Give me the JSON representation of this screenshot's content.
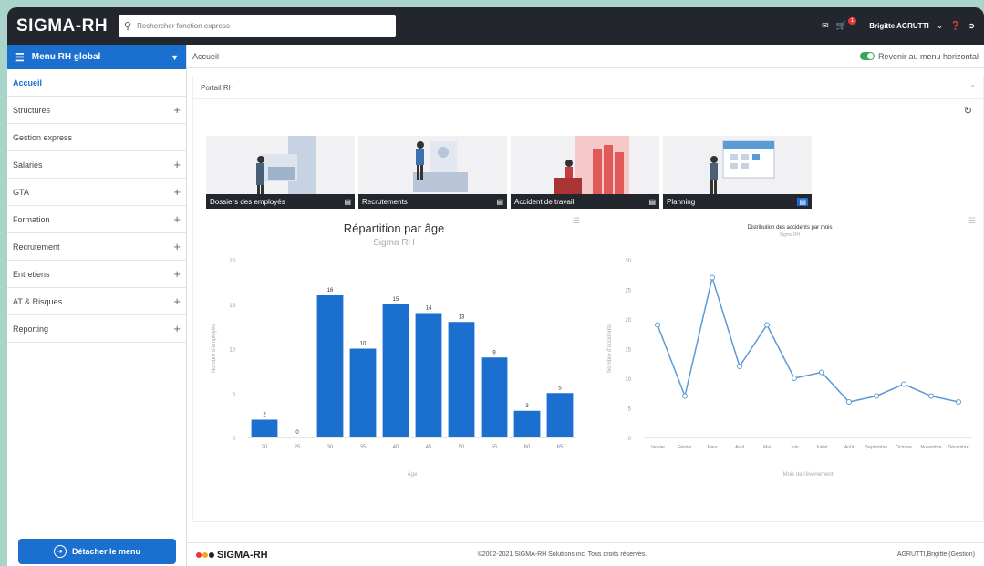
{
  "app": {
    "logo": "SIGMA-RH"
  },
  "search": {
    "placeholder": "Rechercher fonction express"
  },
  "header": {
    "user": "Brigitte AGRUTTI",
    "notif_count": "1"
  },
  "sidebar": {
    "title": "Menu RH global",
    "items": [
      {
        "label": "Accueil",
        "expandable": false,
        "active": true
      },
      {
        "label": "Structures",
        "expandable": true
      },
      {
        "label": "Gestion express",
        "expandable": false
      },
      {
        "label": "Salariés",
        "expandable": true
      },
      {
        "label": "GTA",
        "expandable": true
      },
      {
        "label": "Formation",
        "expandable": true
      },
      {
        "label": "Recrutement",
        "expandable": true
      },
      {
        "label": "Entretiens",
        "expandable": true
      },
      {
        "label": "AT & Risques",
        "expandable": true
      },
      {
        "label": "Reporting",
        "expandable": true
      }
    ],
    "detach_label": "Détacher le menu"
  },
  "breadcrumb": "Accueil",
  "toggle_label": "Revenir au menu horizontal",
  "panel": {
    "title": "Portail RH"
  },
  "tiles": [
    {
      "label": "Dossiers des employés"
    },
    {
      "label": "Recrutements"
    },
    {
      "label": "Accident de travail"
    },
    {
      "label": "Planning"
    }
  ],
  "footer": {
    "logo": "SIGMA-RH",
    "copyright": "©2002-2021 SIGMA-RH Solutions inc. Tous droits réservés.",
    "user": "AGRUTTI,Brigitte (Gestion)"
  },
  "colors": {
    "accent": "#1a6fcf",
    "topbar": "#23262d",
    "line": "#5b9bd5"
  },
  "chart_data": [
    {
      "type": "bar",
      "title": "Répartition par âge",
      "subtitle": "Sigma RH",
      "xlabel": "Âge",
      "ylabel": "Nombre d'employés",
      "categories": [
        "20",
        "25",
        "30",
        "35",
        "40",
        "45",
        "50",
        "55",
        "60",
        "65"
      ],
      "values": [
        2,
        0,
        16,
        10,
        15,
        14,
        13,
        9,
        3,
        5
      ],
      "ylim": [
        0,
        20
      ],
      "yticks": [
        0,
        5,
        10,
        15,
        20
      ]
    },
    {
      "type": "line",
      "title": "Distribution des accidents par mois",
      "subtitle": "Sigma RH",
      "xlabel": "Mois de l'événement",
      "ylabel": "Nombre d'accidents",
      "categories": [
        "Janvier",
        "Février",
        "Mars",
        "Avril",
        "Mai",
        "Juin",
        "Juillet",
        "Août",
        "Septembre",
        "Octobre",
        "Novembre",
        "Décembre"
      ],
      "values": [
        19,
        7,
        27,
        12,
        19,
        10,
        11,
        6,
        7,
        9,
        7,
        6
      ],
      "ylim": [
        0,
        30
      ],
      "yticks": [
        0,
        5,
        10,
        15,
        20,
        25,
        30
      ]
    }
  ]
}
